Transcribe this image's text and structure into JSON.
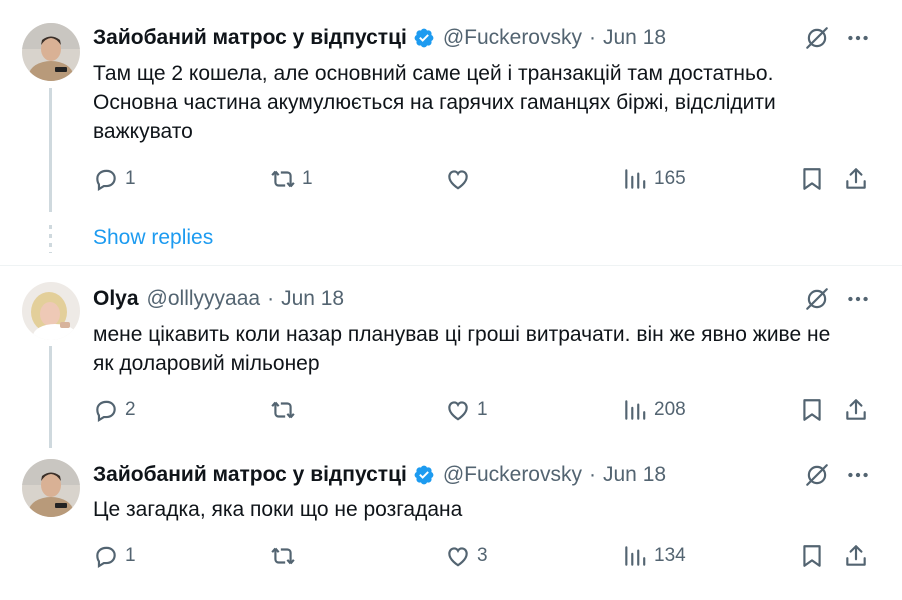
{
  "tweets": [
    {
      "name": "Зайобаний матрос у відпустці",
      "handle": "@Fuckerovsky",
      "separator": "·",
      "date": "Jun 18",
      "text": "Там ще 2 кошела, але основний саме цей і транзакцій там достатньо. Основна частина акумулюється на гарячих гаманцях біржі, відслідити важкувато",
      "replies": "1",
      "reposts": "1",
      "likes": "",
      "views": "165",
      "verified": true
    },
    {
      "name": "Olya",
      "handle": "@olllyyyaaa",
      "separator": "·",
      "date": "Jun 18",
      "text": "мене цікавить коли назар планував ці гроші витрачати. він же явно живе не як доларовий мільонер",
      "replies": "2",
      "reposts": "",
      "likes": "1",
      "views": "208",
      "verified": false
    },
    {
      "name": "Зайобаний матрос у відпустці",
      "handle": "@Fuckerovsky",
      "separator": "·",
      "date": "Jun 18",
      "text": "Це загадка, яка поки що не розгадана",
      "replies": "1",
      "reposts": "",
      "likes": "3",
      "views": "134",
      "verified": true
    }
  ],
  "show_replies_label": "Show replies",
  "colors": {
    "accent": "#1d9bf0",
    "muted": "#536471",
    "text": "#0f1419",
    "divider": "#eff3f4"
  },
  "icons": [
    "grok-icon",
    "more-icon",
    "reply-icon",
    "repost-icon",
    "like-icon",
    "views-icon",
    "bookmark-icon",
    "share-icon",
    "verified-badge-icon"
  ]
}
